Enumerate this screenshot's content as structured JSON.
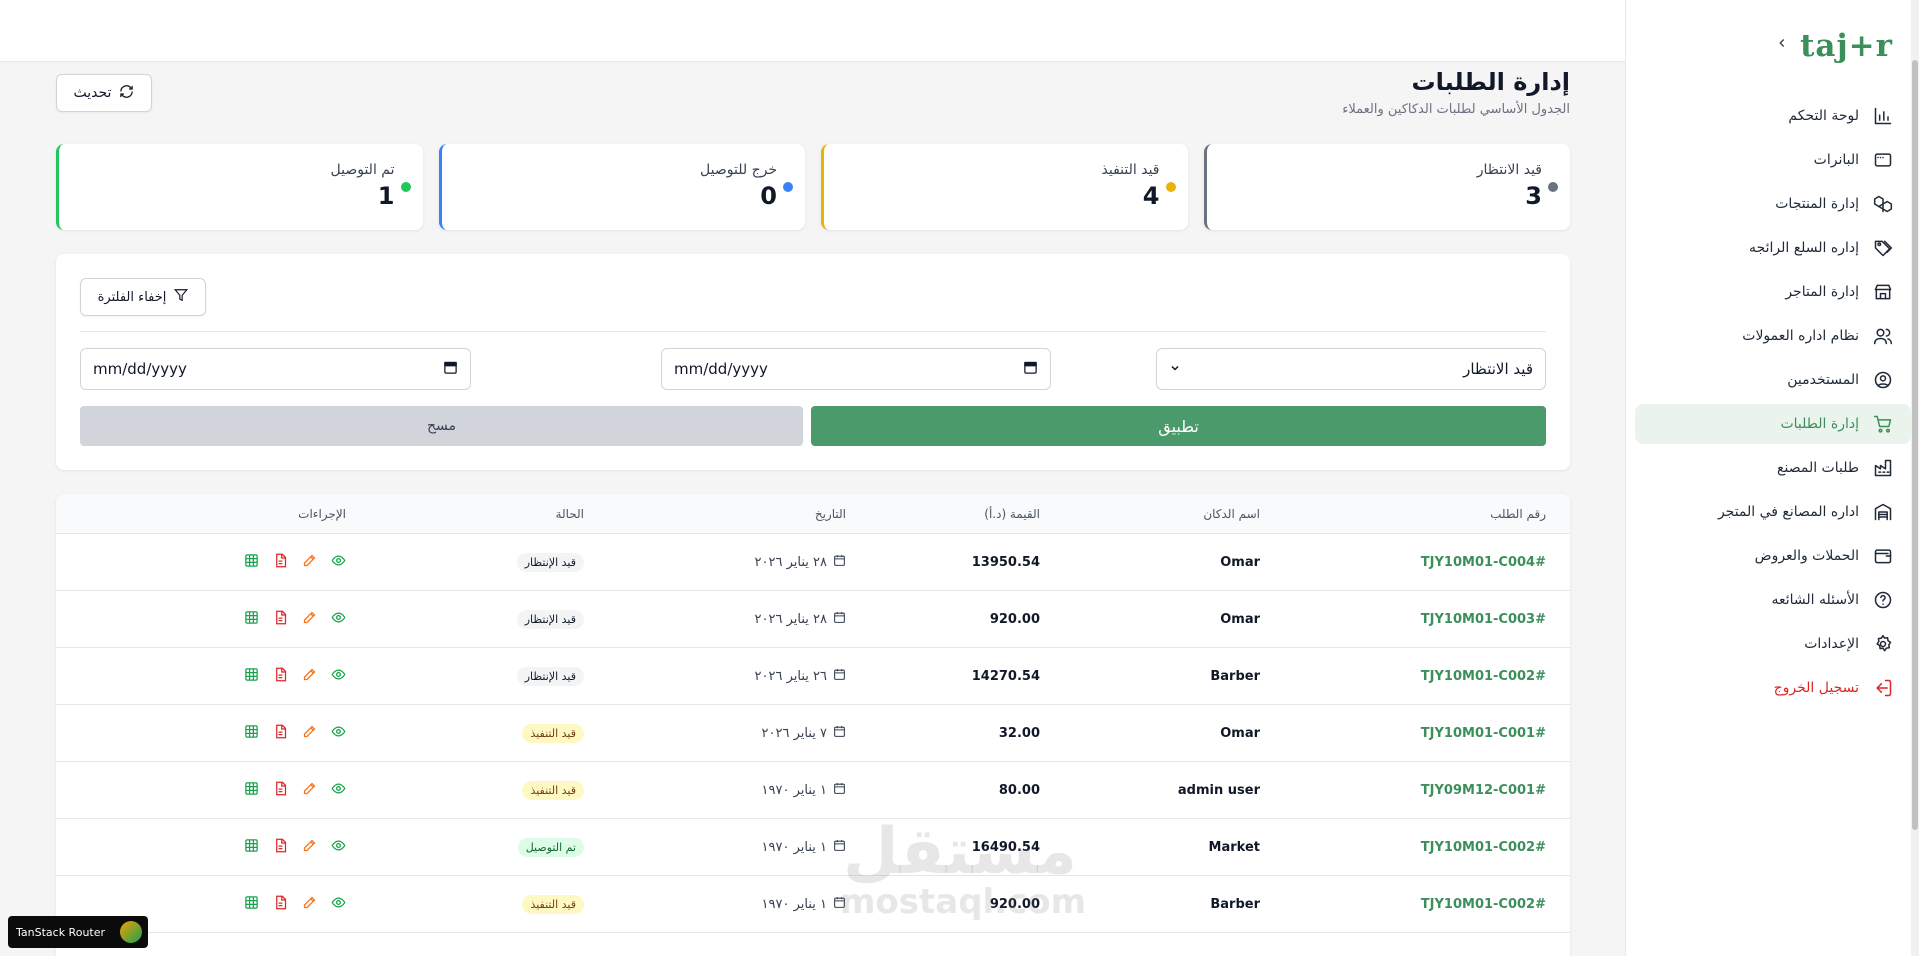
{
  "brand": {
    "logo": "taj+r"
  },
  "sidebar": {
    "items": [
      {
        "label": "لوحة التحكم",
        "icon": "bar-chart-icon"
      },
      {
        "label": "البانرات",
        "icon": "banner-icon"
      },
      {
        "label": "إدارة المنتجات",
        "icon": "boxes-icon"
      },
      {
        "label": "إداره السلع الرائجه",
        "icon": "tags-icon"
      },
      {
        "label": "إدارة المتاجر",
        "icon": "store-icon"
      },
      {
        "label": "نظام اداره العمولات",
        "icon": "users-icon"
      },
      {
        "label": "المستخدمين",
        "icon": "user-circle-icon"
      },
      {
        "label": "إدارة الطلبات",
        "icon": "cart-icon",
        "active": true
      },
      {
        "label": "طلبات المصنع",
        "icon": "factory-icon"
      },
      {
        "label": "اداره المصانع في المتجر",
        "icon": "warehouse-icon"
      },
      {
        "label": "الحملات والعروض",
        "icon": "wallet-icon"
      },
      {
        "label": "الأسئله الشائعه",
        "icon": "help-circle-icon"
      },
      {
        "label": "الإعدادات",
        "icon": "gear-icon"
      },
      {
        "label": "تسجيل الخروج",
        "icon": "logout-icon",
        "danger": true
      }
    ]
  },
  "header": {
    "title": "إدارة الطلبات",
    "subtitle": "الجدول الأساسي لطلبات الدكاكين والعملاء",
    "refresh_label": "تحديث"
  },
  "stats": [
    {
      "label": "قيد الانتظار",
      "value": "3",
      "color": "#6b7280"
    },
    {
      "label": "قيد التنفيذ",
      "value": "4",
      "color": "#eab308"
    },
    {
      "label": "خرج للتوصيل",
      "value": "0",
      "color": "#3b82f6"
    },
    {
      "label": "تم التوصيل",
      "value": "1",
      "color": "#22c55e"
    }
  ],
  "filters": {
    "hide_label": "إخفاء الفلترة",
    "status_value": "قيد الانتظار",
    "date_from_placeholder": "mm/dd/yyyy",
    "date_to_placeholder": "mm/dd/yyyy",
    "apply_label": "تطبيق",
    "clear_label": "مسح"
  },
  "table": {
    "columns": {
      "order": "رقم الطلب",
      "shop": "اسم الدكان",
      "value": "القيمة (د.أ)",
      "date": "التاريخ",
      "status": "الحالة",
      "actions": "الإجراءات"
    },
    "rows": [
      {
        "order": "TJY10M01-C004#",
        "shop": "Omar",
        "value": "13950.54",
        "date": "٢٨ يناير ٢٠٢٦",
        "status": "قيد الإنتظار",
        "status_type": "pending"
      },
      {
        "order": "TJY10M01-C003#",
        "shop": "Omar",
        "value": "920.00",
        "date": "٢٨ يناير ٢٠٢٦",
        "status": "قيد الإنتظار",
        "status_type": "pending"
      },
      {
        "order": "TJY10M01-C002#",
        "shop": "Barber",
        "value": "14270.54",
        "date": "٢٦ يناير ٢٠٢٦",
        "status": "قيد الإنتظار",
        "status_type": "pending"
      },
      {
        "order": "TJY10M01-C001#",
        "shop": "Omar",
        "value": "32.00",
        "date": "٧ يناير ٢٠٢٦",
        "status": "قيد التنفيذ",
        "status_type": "processing"
      },
      {
        "order": "TJY09M12-C001#",
        "shop": "admin user",
        "value": "80.00",
        "date": "١ يناير ١٩٧٠",
        "status": "قيد التنفيذ",
        "status_type": "processing"
      },
      {
        "order": "TJY10M01-C002#",
        "shop": "Market",
        "value": "16490.54",
        "date": "١ يناير ١٩٧٠",
        "status": "تم التوصيل",
        "status_type": "delivered"
      },
      {
        "order": "TJY10M01-C002#",
        "shop": "Barber",
        "value": "920.00",
        "date": "١ يناير ١٩٧٠",
        "status": "قيد التنفيذ",
        "status_type": "processing"
      }
    ]
  },
  "devtools": {
    "label": "TanStack Router"
  },
  "watermark": {
    "line1": "مستقل",
    "line2": "mostaql.com"
  },
  "colors": {
    "brand_green": "#3b8f5a",
    "active_bg": "#eaf4ed",
    "danger": "#dc2626"
  }
}
